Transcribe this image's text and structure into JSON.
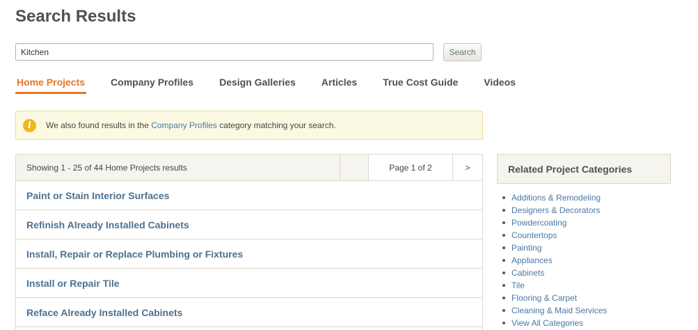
{
  "page": {
    "title": "Search Results"
  },
  "search": {
    "value": "Kitchen",
    "button_label": "Search"
  },
  "tabs": [
    {
      "label": "Home Projects",
      "active": true
    },
    {
      "label": "Company Profiles"
    },
    {
      "label": "Design Galleries"
    },
    {
      "label": "Articles"
    },
    {
      "label": "True Cost Guide"
    },
    {
      "label": "Videos"
    }
  ],
  "notice": {
    "icon": "info-icon",
    "prefix": "We also found results in the",
    "link": "Company Profiles",
    "suffix": "category matching your search."
  },
  "results": {
    "count_text": "Showing 1 - 25 of 44 Home Projects results",
    "page_text": "Page 1 of 2",
    "next_label": ">",
    "items": [
      "Paint or Stain Interior Surfaces",
      "Refinish Already Installed Cabinets",
      "Install, Repair or Replace Plumbing or Fixtures",
      "Install or Repair Tile",
      "Reface Already Installed Cabinets"
    ]
  },
  "related": {
    "title": "Related Project Categories",
    "items": [
      "Additions & Remodeling",
      "Designers & Decorators",
      "Powdercoating",
      "Countertops",
      "Painting",
      "Appliances",
      "Cabinets",
      "Tile",
      "Flooring & Carpet",
      "Cleaning & Maid Services",
      "View All Categories"
    ]
  },
  "colors": {
    "accent": "#e47527",
    "link": "#4a77a6",
    "notice_bg": "#fcf9e2",
    "info_icon": "#f2b51d"
  }
}
